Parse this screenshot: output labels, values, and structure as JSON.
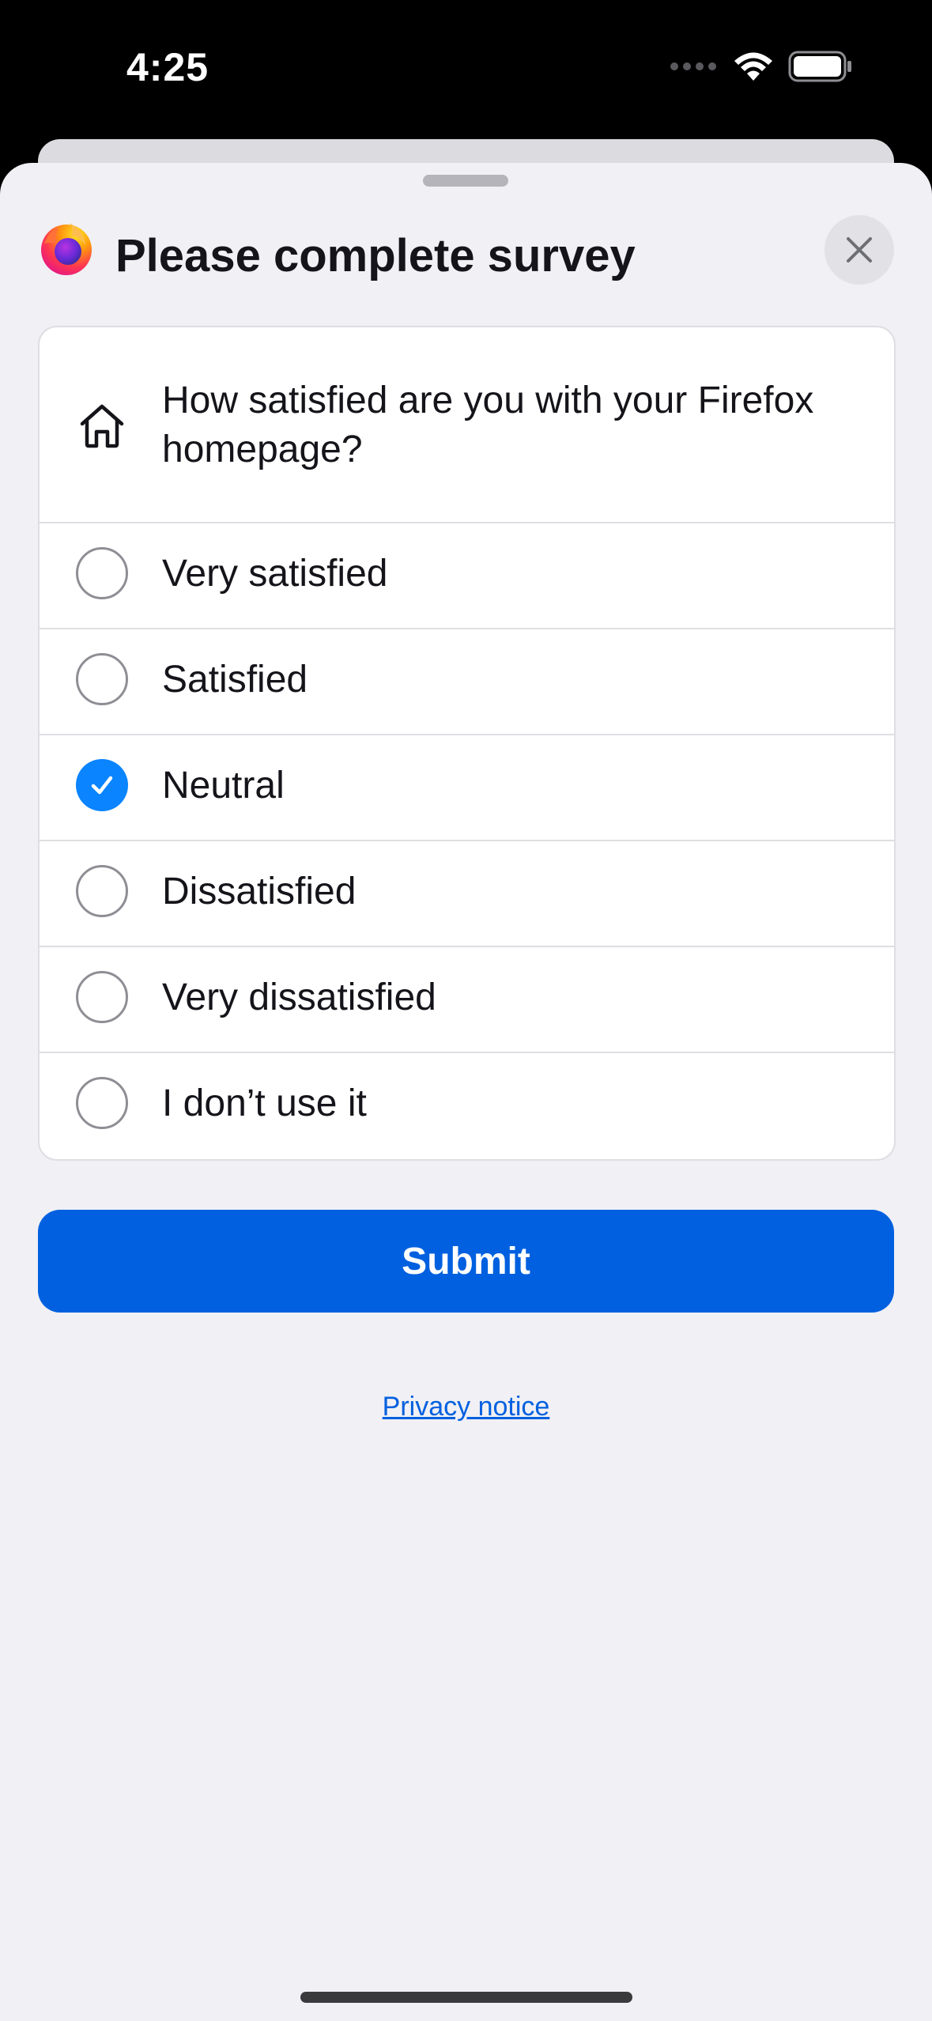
{
  "status_bar": {
    "time": "4:25"
  },
  "header": {
    "title": "Please complete survey",
    "logo_icon": "firefox-logo",
    "close_icon": "close-icon"
  },
  "survey": {
    "question_icon": "home-icon",
    "question": "How satisfied are you with your Firefox homepage?",
    "options": [
      {
        "label": "Very satisfied",
        "selected": false
      },
      {
        "label": "Satisfied",
        "selected": false
      },
      {
        "label": "Neutral",
        "selected": true
      },
      {
        "label": "Dissatisfied",
        "selected": false
      },
      {
        "label": "Very dissatisfied",
        "selected": false
      },
      {
        "label": "I don’t use it",
        "selected": false
      }
    ]
  },
  "actions": {
    "submit_label": "Submit",
    "privacy_label": "Privacy notice"
  },
  "colors": {
    "accent": "#0060df",
    "radio_checked": "#0a84ff",
    "sheet_background": "#f0f0f5"
  }
}
